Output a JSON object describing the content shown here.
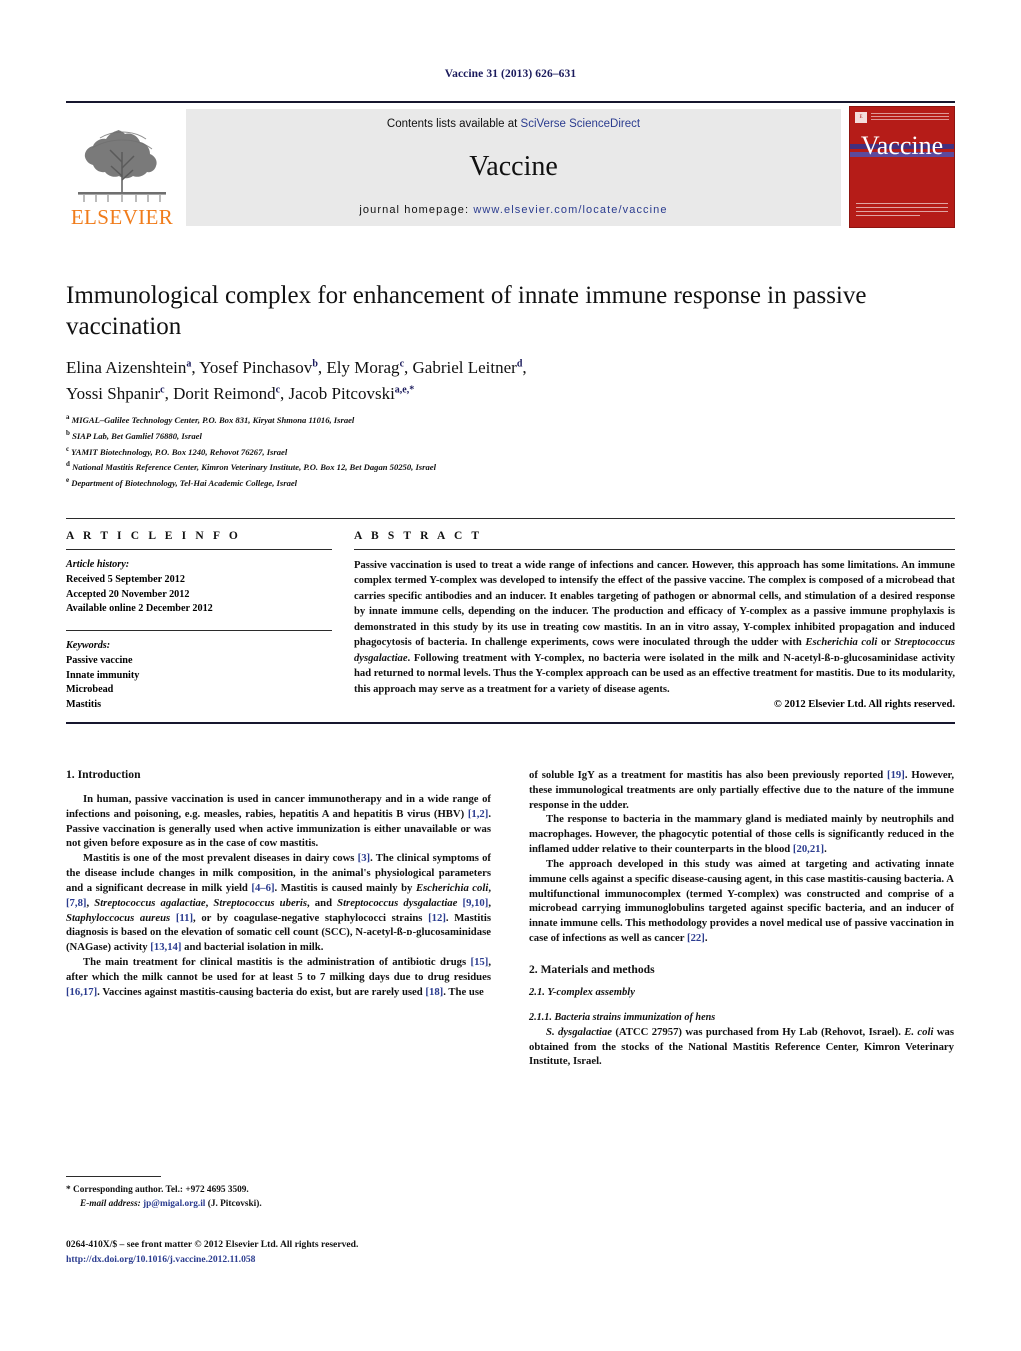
{
  "running_head": "Vaccine 31 (2013) 626–631",
  "masthead": {
    "elsevier_word": "ELSEVIER",
    "contents_prefix": "Contents lists available at ",
    "contents_link": "SciVerse ScienceDirect",
    "journal_name": "Vaccine",
    "homepage_prefix": "journal homepage: ",
    "homepage_url": "www.elsevier.com/locate/vaccine",
    "cover_title": "Vaccine"
  },
  "article": {
    "title": "Immunological complex for enhancement of innate immune response in passive vaccination",
    "authors_line_1": "Elina Aizenshtein",
    "authors": [
      {
        "name": "Elina Aizenshtein",
        "sup": "a"
      },
      {
        "name": "Yosef Pinchasov",
        "sup": "b"
      },
      {
        "name": "Ely Morag",
        "sup": "c"
      },
      {
        "name": "Gabriel Leitner",
        "sup": "d"
      },
      {
        "name": "Yossi Shpanir",
        "sup": "c"
      },
      {
        "name": "Dorit Reimond",
        "sup": "c"
      },
      {
        "name": "Jacob Pitcovski",
        "sup": "a,e,*"
      }
    ],
    "affiliations": [
      {
        "marker": "a",
        "text": "MIGAL–Galilee Technology Center, P.O. Box 831, Kiryat Shmona 11016, Israel"
      },
      {
        "marker": "b",
        "text": "SIAP Lab, Bet Gamliel 76880, Israel"
      },
      {
        "marker": "c",
        "text": "YAMIT Biotechnology, P.O. Box 1240, Rehovot 76267, Israel"
      },
      {
        "marker": "d",
        "text": "National Mastitis Reference Center, Kimron Veterinary Institute, P.O. Box 12, Bet Dagan 50250, Israel"
      },
      {
        "marker": "e",
        "text": "Department of Biotechnology, Tel-Hai Academic College, Israel"
      }
    ]
  },
  "article_info": {
    "label": "A R T I C L E   I N F O",
    "history_title": "Article history:",
    "history": [
      "Received 5 September 2012",
      "Accepted 20 November 2012",
      "Available online 2 December 2012"
    ],
    "keywords_title": "Keywords:",
    "keywords": [
      "Passive vaccine",
      "Innate immunity",
      "Microbead",
      "Mastitis"
    ]
  },
  "abstract": {
    "label": "A B S T R A C T",
    "paragraph_part_1": "Passive vaccination is used to treat a wide range of infections and cancer. However, this approach has some limitations. An immune complex termed Y-complex was developed to intensify the effect of the passive vaccine. The complex is composed of a microbead that carries specific antibodies and an inducer. It enables targeting of pathogen or abnormal cells, and stimulation of a desired response by innate immune cells, depending on the inducer. The production and efficacy of Y-complex as a passive immune prophylaxis is demonstrated in this study by its use in treating cow mastitis. In an in vitro assay, Y-complex inhibited propagation and induced phagocytosis of bacteria. In challenge experiments, cows were inoculated through the udder with ",
    "italic_1": "Escherichia coli",
    "mid_1": " or ",
    "italic_2": "Streptococcus dysgalactiae",
    "paragraph_part_2": ". Following treatment with Y-complex, no bacteria were isolated in the milk and N-acetyl-ß-ᴅ-glucosaminidase activity had returned to normal levels. Thus the Y-complex approach can be used as an effective treatment for mastitis. Due to its modularity, this approach may serve as a treatment for a variety of disease agents.",
    "copyright": "© 2012 Elsevier Ltd. All rights reserved."
  },
  "sections": {
    "introduction_heading": "1.  Introduction",
    "intro_p1_a": "In human, passive vaccination is used in cancer immunotherapy and in a wide range of infections and poisoning, e.g. measles, rabies, hepatitis A and hepatitis B virus (HBV) ",
    "intro_p1_ref": "[1,2]",
    "intro_p1_b": ". Passive vaccination is generally used when active immunization is either unavailable or was not given before exposure as in the case of cow mastitis.",
    "intro_p2_a": "Mastitis is one of the most prevalent diseases in dairy cows ",
    "intro_p2_ref1": "[3]",
    "intro_p2_b": ". The clinical symptoms of the disease include changes in milk composition, in the animal's physiological parameters and a significant decrease in milk yield ",
    "intro_p2_ref2": "[4–6]",
    "intro_p2_c": ". Mastitis is caused mainly by ",
    "intro_p2_it1": "Escherichia coli",
    "intro_p2_d": ", ",
    "intro_p2_ref3": "[7,8]",
    "intro_p2_e": ", ",
    "intro_p2_it2": "Streptococcus agalactiae",
    "intro_p2_f": ", ",
    "intro_p2_it3": "Streptococcus uberis",
    "intro_p2_g": ", and ",
    "intro_p2_it4": "Streptococcus dysgalactiae",
    "intro_p2_h": " ",
    "intro_p2_ref4": "[9,10]",
    "intro_p2_i": ", ",
    "intro_p2_it5": "Staphyloccocus aureus",
    "intro_p2_j": " ",
    "intro_p2_ref5": "[11]",
    "intro_p2_k": ", or by coagulase-negative staphylococci strains ",
    "intro_p2_ref6": "[12]",
    "intro_p2_l": ". Mastitis diagnosis is based on the elevation of somatic cell count (SCC), N-acetyl-ß-ᴅ-glucosaminidase (NAGase) activity ",
    "intro_p2_ref7": "[13,14]",
    "intro_p2_m": " and bacterial isolation in milk.",
    "intro_p3_a": "The main treatment for clinical mastitis is the administration of antibiotic drugs ",
    "intro_p3_ref1": "[15]",
    "intro_p3_b": ", after which the milk cannot be used for at least 5 to 7 milking days due to drug residues ",
    "intro_p3_ref2": "[16,17]",
    "intro_p3_c": ". Vaccines against mastitis-causing bacteria do exist, but are rarely used ",
    "intro_p3_ref3": "[18]",
    "intro_p3_d": ". The use",
    "intro_p4_a": "of soluble IgY as a treatment for mastitis has also been previously reported ",
    "intro_p4_ref": "[19]",
    "intro_p4_b": ". However, these immunological treatments are only partially effective due to the nature of the immune response in the udder.",
    "intro_p5_a": "The response to bacteria in the mammary gland is mediated mainly by neutrophils and macrophages. However, the phagocytic potential of those cells is significantly reduced in the inflamed udder relative to their counterparts in the blood ",
    "intro_p5_ref": "[20,21]",
    "intro_p5_b": ".",
    "intro_p6_a": "The approach developed in this study was aimed at targeting and activating innate immune cells against a specific disease-causing agent, in this case mastitis-causing bacteria. A multifunctional immunocomplex (termed Y-complex) was constructed and comprise of a microbead carrying immunoglobulins targeted against specific bacteria, and an inducer of innate immune cells. This methodology provides a novel medical use of passive vaccination in case of infections as well as cancer ",
    "intro_p6_ref": "[22]",
    "intro_p6_b": ".",
    "methods_heading": "2.  Materials and methods",
    "methods_sub_1": "2.1.  Y-complex assembly",
    "methods_sub_1_1": "2.1.1.  Bacteria strains immunization of hens",
    "methods_p1_it1": "S. dysgalactiae",
    "methods_p1_a": " (ATCC 27957) was purchased from Hy Lab (Rehovot, Israel). ",
    "methods_p1_it2": "E. coli",
    "methods_p1_b": " was obtained from the stocks of the National Mastitis Reference Center, Kimron Veterinary Institute, Israel."
  },
  "footer": {
    "corresponding_marker": "*",
    "corresponding_text": "Corresponding author. Tel.: +972 4695 3509.",
    "email_label": "E-mail address:",
    "email": "jp@migal.org.il",
    "email_suffix": "(J. Pitcovski).",
    "issn_line": "0264-410X/$ – see front matter © 2012 Elsevier Ltd. All rights reserved.",
    "doi_line": "http://dx.doi.org/10.1016/j.vaccine.2012.11.058"
  },
  "colors": {
    "link_blue": "#2b3c8f",
    "elsevier_orange": "#f07c1b",
    "cover_red": "#b51c18",
    "cover_purple": "#43307e",
    "rule_dark": "#16162e"
  }
}
